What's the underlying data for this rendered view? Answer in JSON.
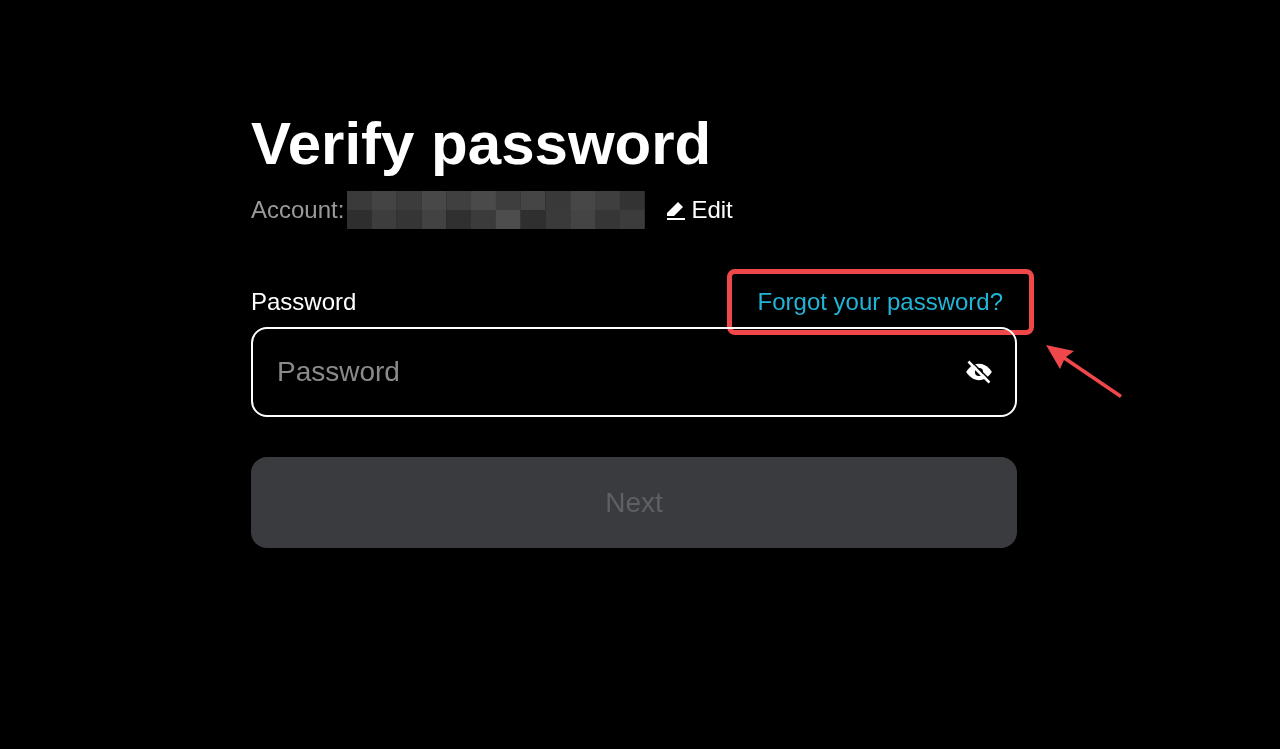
{
  "title": "Verify password",
  "account": {
    "label": "Account:",
    "value_redacted": true,
    "edit_label": "Edit"
  },
  "password": {
    "label": "Password",
    "forgot_link": "Forgot your password?",
    "forgot_highlighted": true,
    "placeholder": "Password",
    "visible": false
  },
  "next_button": {
    "label": "Next",
    "disabled": true
  }
}
